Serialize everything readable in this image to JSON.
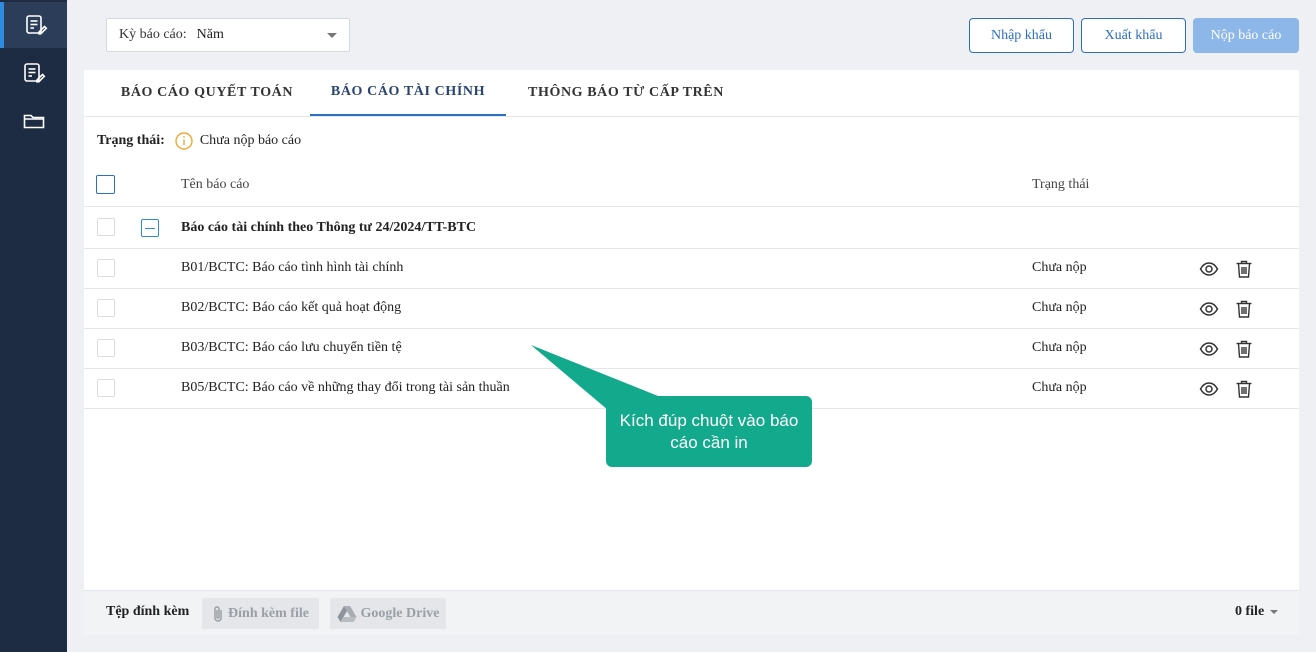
{
  "sidebar": {
    "items": [
      {
        "icon": "report-edit-icon",
        "active": true
      },
      {
        "icon": "report-list-icon",
        "active": false
      },
      {
        "icon": "folder-icon",
        "active": false
      }
    ]
  },
  "toolbar": {
    "period_label": "Kỳ báo cáo:",
    "period_value": "Năm",
    "import_label": "Nhập khẩu",
    "export_label": "Xuất khẩu",
    "submit_label": "Nộp báo cáo"
  },
  "tabs": [
    {
      "label": "BÁO CÁO QUYẾT TOÁN",
      "active": false
    },
    {
      "label": "BÁO CÁO TÀI CHÍNH",
      "active": true
    },
    {
      "label": "THÔNG BÁO TỪ CẤP TRÊN",
      "active": false
    }
  ],
  "status": {
    "label": "Trạng thái:",
    "value": "Chưa nộp báo cáo"
  },
  "table": {
    "headers": {
      "name": "Tên báo cáo",
      "status": "Trạng thái"
    },
    "group": {
      "title": "Báo cáo tài chính theo Thông tư 24/2024/TT-BTC"
    },
    "rows": [
      {
        "name": "B01/BCTC: Báo cáo tình hình tài chính",
        "status": "Chưa nộp"
      },
      {
        "name": "B02/BCTC: Báo cáo kết quả hoạt động",
        "status": "Chưa nộp"
      },
      {
        "name": "B03/BCTC: Báo cáo lưu chuyển tiền tệ",
        "status": "Chưa nộp"
      },
      {
        "name": "B05/BCTC: Báo cáo về những thay đổi trong tài sản thuần",
        "status": "Chưa nộp"
      }
    ]
  },
  "footer": {
    "attach_label": "Tệp đính kèm",
    "attach_file_label": "Đính kèm file",
    "drive_label": "Google Drive",
    "file_count": "0 file"
  },
  "callout": {
    "text": "Kích đúp chuột vào báo cáo cần in"
  },
  "colors": {
    "sidebar_bg": "#1d2c43",
    "accent": "#2d6fbf",
    "callout": "#12a98c",
    "status_warning": "#f0a830"
  }
}
